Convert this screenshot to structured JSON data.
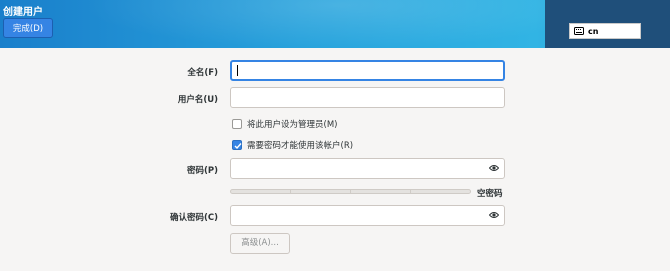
{
  "header": {
    "title": "创建用户",
    "done_label": "完成(D)",
    "keyboard_layout": "cn"
  },
  "form": {
    "full_name": {
      "label": "全名(F)",
      "value": ""
    },
    "username": {
      "label": "用户名(U)",
      "value": ""
    },
    "admin_checkbox": {
      "label": "将此用户设为管理员(M)",
      "checked": false
    },
    "require_password_checkbox": {
      "label": "需要密码才能使用该帐户(R)",
      "checked": true
    },
    "password": {
      "label": "密码(P)",
      "value": ""
    },
    "password_strength": {
      "label": "空密码",
      "level": 0
    },
    "confirm_password": {
      "label": "确认密码(C)",
      "value": ""
    },
    "advanced_label": "高级(A)..."
  },
  "colors": {
    "accent": "#3584e4",
    "header_blue": "#27a2dc",
    "header_dark": "#1f4f7a",
    "background": "#f6f5f4"
  },
  "icons": {
    "keyboard": "keyboard-icon",
    "reveal_password": "eye-icon",
    "check": "checkmark-icon"
  }
}
